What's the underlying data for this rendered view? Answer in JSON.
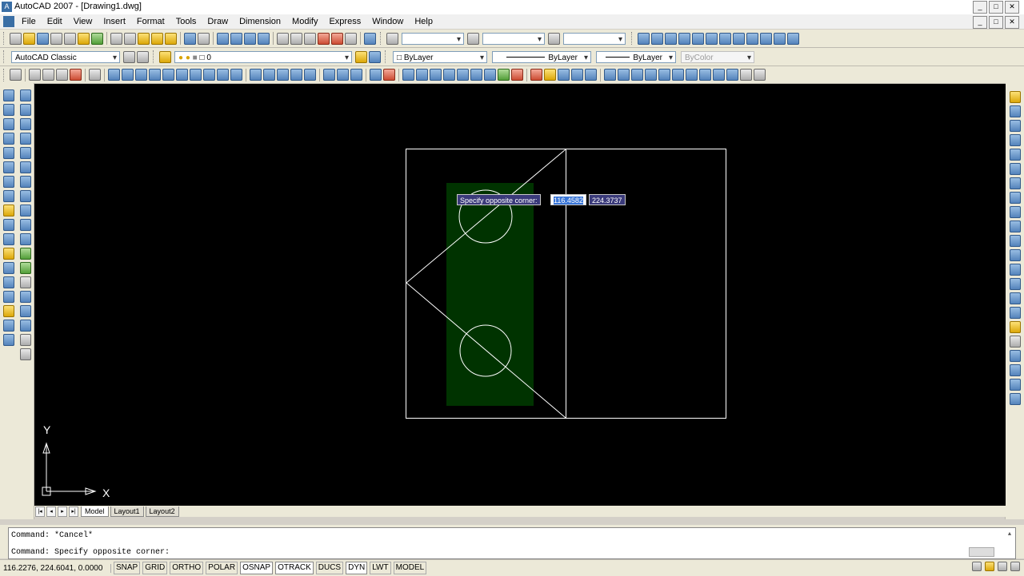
{
  "app": {
    "title": "AutoCAD 2007 - [Drawing1.dwg]",
    "window_buttons": [
      "_",
      "□",
      "✕"
    ],
    "doc_buttons": [
      "_",
      "□",
      "✕"
    ]
  },
  "menu": [
    "File",
    "Edit",
    "View",
    "Insert",
    "Format",
    "Tools",
    "Draw",
    "Dimension",
    "Modify",
    "Express",
    "Window",
    "Help"
  ],
  "toolbars": {
    "workspace": "AutoCAD Classic",
    "layer": "0",
    "color": "ByLayer",
    "linetype": "ByLayer",
    "lineweight": "ByLayer",
    "plotstyle": "ByColor"
  },
  "dynamic_input": {
    "prompt": "Specify opposite corner:",
    "x_value": "116.4582",
    "y_value": "224.3737"
  },
  "ucs": {
    "x_label": "X",
    "y_label": "Y"
  },
  "tabs": [
    "Model",
    "Layout1",
    "Layout2"
  ],
  "command": {
    "line1": "Command: *Cancel*",
    "line2": "Command: Specify opposite corner:"
  },
  "status": {
    "coordinates": "116.2276, 224.6041, 0.0000",
    "buttons": [
      "SNAP",
      "GRID",
      "ORTHO",
      "POLAR",
      "OSNAP",
      "OTRACK",
      "DUCS",
      "DYN",
      "LWT",
      "MODEL"
    ]
  },
  "colors": {
    "canvas_bg": "#000000",
    "selection_fill": "#003300",
    "geometry": "#ffffff"
  }
}
